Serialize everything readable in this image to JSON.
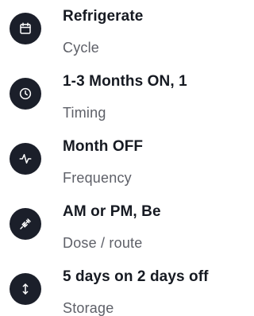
{
  "items": [
    {
      "title": "Refrigerate",
      "subtitle": "Cycle",
      "icon": "calendar-icon"
    },
    {
      "title": "1-3 Months ON, 1",
      "subtitle": "Timing",
      "icon": "clock-icon"
    },
    {
      "title": "Month OFF",
      "subtitle": "Frequency",
      "icon": "pulse-icon"
    },
    {
      "title": "AM or PM, Be",
      "subtitle": "Dose / route",
      "icon": "syringe-icon"
    },
    {
      "title": "5 days on 2 days off",
      "subtitle": "Storage",
      "icon": "vertical-arrows-icon"
    }
  ],
  "colors": {
    "icon_background": "#1b1f2a",
    "icon_foreground": "#ffffff",
    "title": "#161a22",
    "subtitle": "#5e6068"
  }
}
